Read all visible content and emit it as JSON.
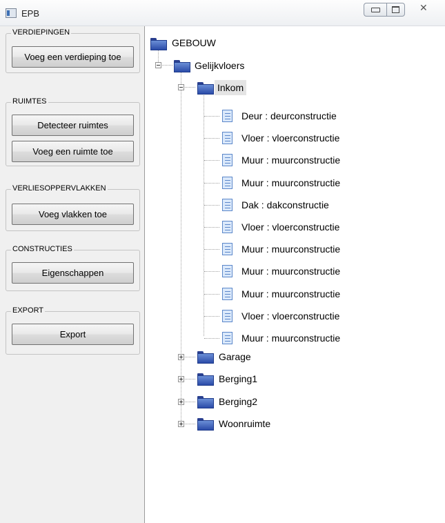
{
  "window": {
    "title": "EPB",
    "close_glyph": "✕"
  },
  "groups": [
    {
      "title": "VERDIEPINGEN",
      "buttons": [
        "Voeg een verdieping toe"
      ]
    },
    {
      "title": "RUIMTES",
      "buttons": [
        "Detecteer ruimtes",
        "Voeg een ruimte toe"
      ]
    },
    {
      "title": "VERLIESOPPERVLAKKEN",
      "buttons": [
        "Voeg vlakken toe"
      ]
    },
    {
      "title": "CONSTRUCTIES",
      "buttons": [
        "Eigenschappen"
      ]
    },
    {
      "title": "EXPORT",
      "buttons": [
        "Export"
      ]
    }
  ],
  "tree": {
    "root": "GEBOUW",
    "floor": "Gelijkvloers",
    "selected_room": "Inkom",
    "inkom_children": [
      "Deur : deurconstructie",
      "Vloer : vloerconstructie",
      "Muur : muurconstructie",
      "Muur : muurconstructie",
      "Dak : dakconstructie",
      "Vloer : vloerconstructie",
      "Muur : muurconstructie",
      "Muur : muurconstructie",
      "Muur : muurconstructie",
      "Vloer : vloerconstructie",
      "Muur : muurconstructie"
    ],
    "other_rooms": [
      "Garage",
      "Berging1",
      "Berging2",
      "Woonruimte"
    ]
  }
}
